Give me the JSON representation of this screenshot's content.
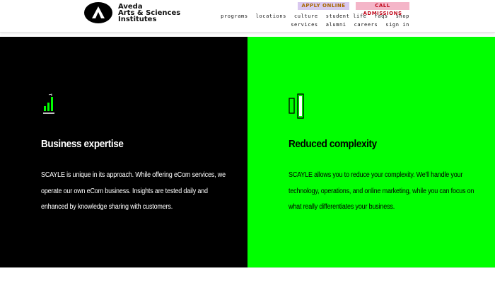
{
  "header": {
    "logo": {
      "line1": "Aveda",
      "line2": "Arts & Sciences",
      "line3": "Institutes",
      "icon": "aveda-triangle-icon"
    },
    "buttons": {
      "apply_label": "APPLY ONLINE",
      "call_label": "CALL ADMISSIONS"
    },
    "nav_top": [
      "programs",
      "locations",
      "culture",
      "student life",
      "faqs",
      "shop"
    ],
    "nav_bottom": [
      "services",
      "alumni",
      "careers",
      "sign in"
    ]
  },
  "features": [
    {
      "icon": "growth-bars-icon",
      "title": "Business expertise",
      "body": [
        "SCAYLE is unique in its approach. While offering eCom services, we",
        "operate our own eCom business. Insights are tested daily and",
        "enhanced by knowledge sharing with customers."
      ],
      "background": "#000000",
      "text_color": "#ffffff"
    },
    {
      "icon": "reduce-complexity-icon",
      "title": "Reduced complexity",
      "body": [
        "SCAYLE allows you to reduce your complexity. We'll handle your",
        "technology, operations, and online marketing, while you can focus on",
        "what really differentiates your business."
      ],
      "background": "#00ff00",
      "text_color": "#000000"
    }
  ],
  "colors": {
    "apply_bg": "#d9c8ef",
    "apply_text": "#a86800",
    "call_bg": "#f4b5c8",
    "call_text": "#c20b1e",
    "accent_green": "#00ff00"
  }
}
